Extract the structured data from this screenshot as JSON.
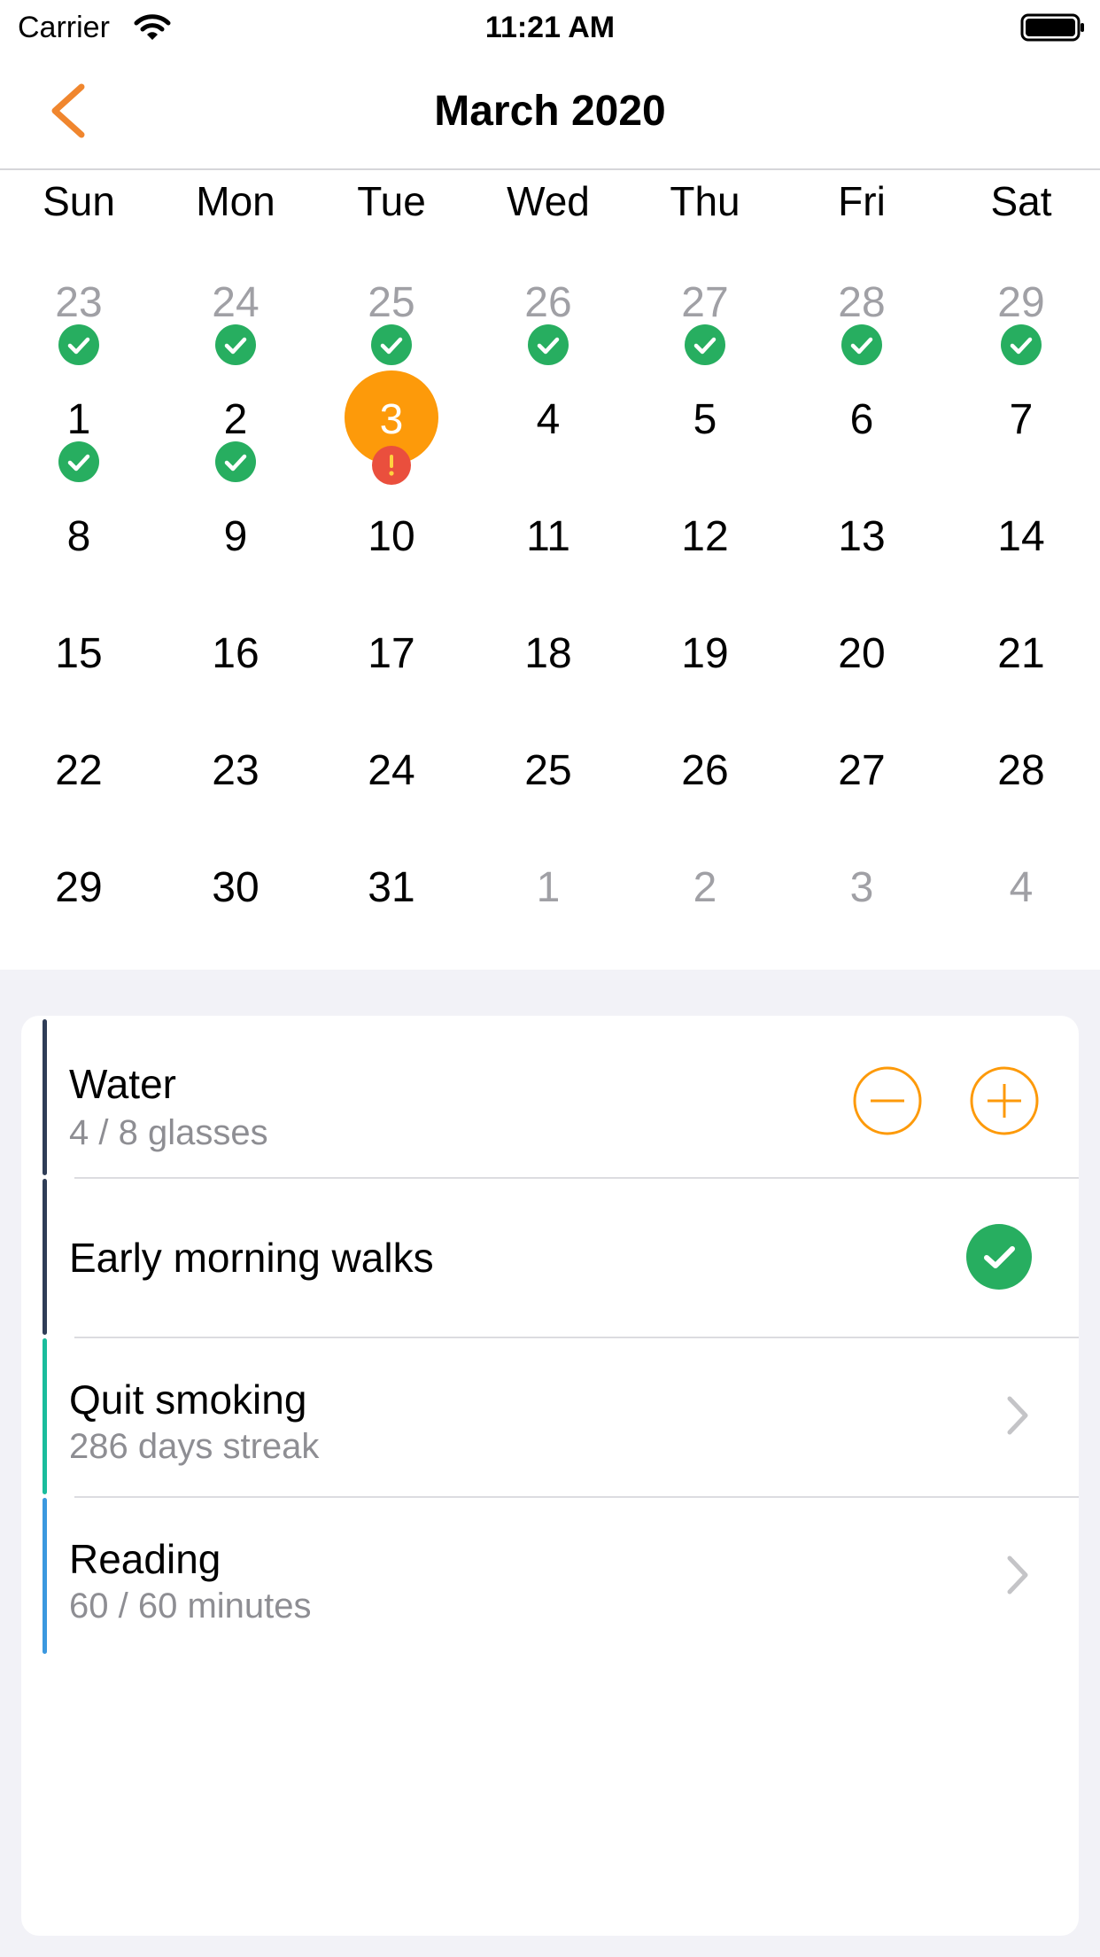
{
  "status_bar": {
    "carrier": "Carrier",
    "time": "11:21 AM"
  },
  "nav": {
    "title": "March 2020"
  },
  "colors": {
    "accent": "#fd9a0a",
    "back": "#f0862e",
    "check": "#27ae60",
    "warning": "#ea4f3d",
    "walk_bar": "#2f3d57",
    "smoke_bar": "#1abc9c",
    "read_bar": "#3b98df"
  },
  "calendar": {
    "weekdays": [
      "Sun",
      "Mon",
      "Tue",
      "Wed",
      "Thu",
      "Fri",
      "Sat"
    ],
    "weeks": [
      [
        {
          "d": "23",
          "muted": true,
          "status": "done"
        },
        {
          "d": "24",
          "muted": true,
          "status": "done"
        },
        {
          "d": "25",
          "muted": true,
          "status": "done"
        },
        {
          "d": "26",
          "muted": true,
          "status": "done"
        },
        {
          "d": "27",
          "muted": true,
          "status": "done"
        },
        {
          "d": "28",
          "muted": true,
          "status": "done"
        },
        {
          "d": "29",
          "muted": true,
          "status": "done"
        }
      ],
      [
        {
          "d": "1",
          "status": "done"
        },
        {
          "d": "2",
          "status": "done"
        },
        {
          "d": "3",
          "today": true,
          "status": "warning"
        },
        {
          "d": "4"
        },
        {
          "d": "5"
        },
        {
          "d": "6"
        },
        {
          "d": "7"
        }
      ],
      [
        {
          "d": "8"
        },
        {
          "d": "9"
        },
        {
          "d": "10"
        },
        {
          "d": "11"
        },
        {
          "d": "12"
        },
        {
          "d": "13"
        },
        {
          "d": "14"
        }
      ],
      [
        {
          "d": "15"
        },
        {
          "d": "16"
        },
        {
          "d": "17"
        },
        {
          "d": "18"
        },
        {
          "d": "19"
        },
        {
          "d": "20"
        },
        {
          "d": "21"
        }
      ],
      [
        {
          "d": "22"
        },
        {
          "d": "23"
        },
        {
          "d": "24"
        },
        {
          "d": "25"
        },
        {
          "d": "26"
        },
        {
          "d": "27"
        },
        {
          "d": "28"
        }
      ],
      [
        {
          "d": "29"
        },
        {
          "d": "30"
        },
        {
          "d": "31"
        },
        {
          "d": "1",
          "muted": true
        },
        {
          "d": "2",
          "muted": true
        },
        {
          "d": "3",
          "muted": true
        },
        {
          "d": "4",
          "muted": true
        }
      ]
    ]
  },
  "habits": {
    "water": {
      "title": "Water",
      "subtitle": "4 / 8 glasses",
      "icons": [
        "minus-circle-icon",
        "plus-circle-icon"
      ]
    },
    "walks": {
      "title": "Early morning walks",
      "icon": "check-circle-icon"
    },
    "smoking": {
      "title": "Quit smoking",
      "subtitle": "286 days streak",
      "icon": "chevron-right-icon"
    },
    "reading": {
      "title": "Reading",
      "subtitle": "60 / 60 minutes",
      "icon": "chevron-right-icon"
    }
  }
}
